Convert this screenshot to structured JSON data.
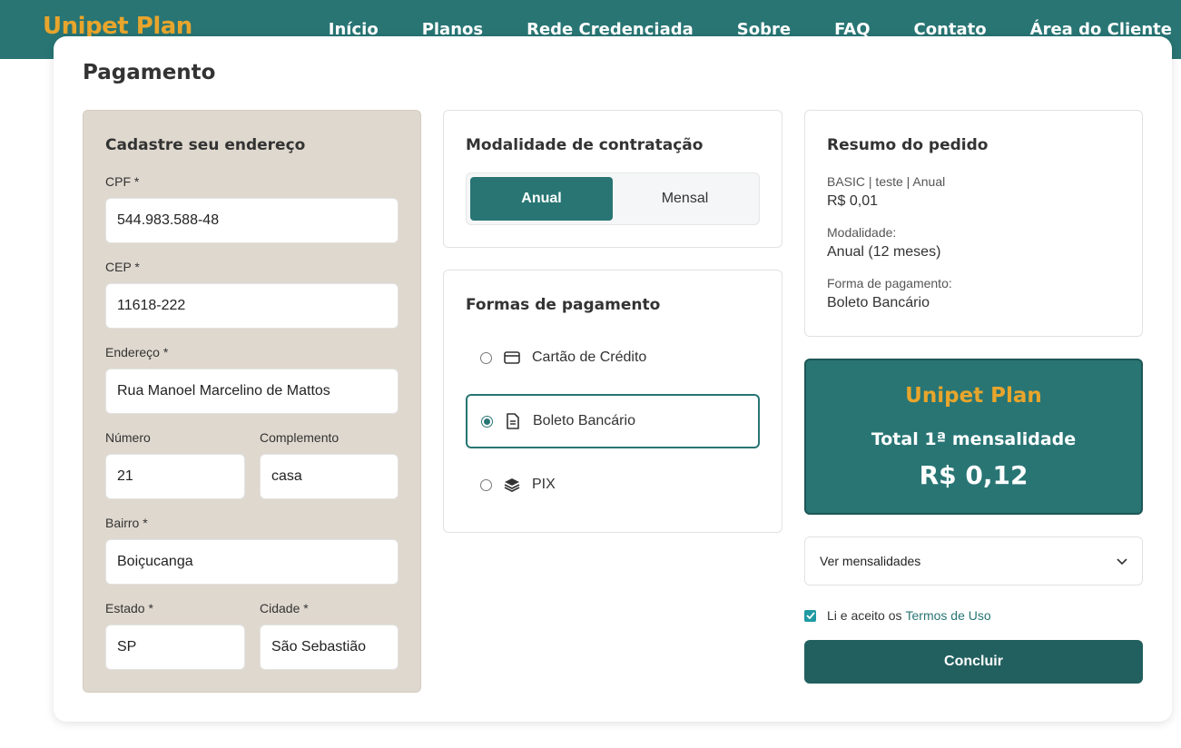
{
  "header": {
    "logo_text": "Unipet Plan",
    "nav": [
      "Início",
      "Planos",
      "Rede Credenciada",
      "Sobre",
      "FAQ",
      "Contato",
      "Área do Cliente"
    ]
  },
  "page_title": "Pagamento",
  "address": {
    "title": "Cadastre seu endereço",
    "cpf_label": "CPF *",
    "cpf_value": "544.983.588-48",
    "cep_label": "CEP *",
    "cep_value": "11618-222",
    "endereco_label": "Endereço *",
    "endereco_value": "Rua Manoel Marcelino de Mattos",
    "numero_label": "Número",
    "numero_value": "21",
    "complemento_label": "Complemento",
    "complemento_value": "casa",
    "bairro_label": "Bairro *",
    "bairro_value": "Boiçucanga",
    "estado_label": "Estado *",
    "estado_value": "SP",
    "cidade_label": "Cidade *",
    "cidade_value": "São Sebastião"
  },
  "modalidade": {
    "title": "Modalidade de contratação",
    "option_anual": "Anual",
    "option_mensal": "Mensal",
    "selected": "Anual"
  },
  "pagamento": {
    "title": "Formas de pagamento",
    "options": [
      "Cartão de Crédito",
      "Boleto Bancário",
      "PIX"
    ],
    "selected": "Boleto Bancário"
  },
  "resumo": {
    "title": "Resumo do pedido",
    "plan_line": "BASIC | teste | Anual",
    "plan_price": "R$ 0,01",
    "modalidade_label": "Modalidade:",
    "modalidade_value": "Anual (12 meses)",
    "forma_label": "Forma de pagamento:",
    "forma_value": "Boleto Bancário"
  },
  "total": {
    "logo_text": "Unipet Plan",
    "label": "Total 1ª mensalidade",
    "value": "R$ 0,12"
  },
  "ver_mensalidades": "Ver mensalidades",
  "terms": {
    "text": "Li e aceito os",
    "link": "Termos de Uso",
    "checked": true
  },
  "submit_label": "Concluir",
  "colors": {
    "primary": "#287574",
    "accent": "#e8a52c",
    "address_bg": "#dfd8ce"
  }
}
